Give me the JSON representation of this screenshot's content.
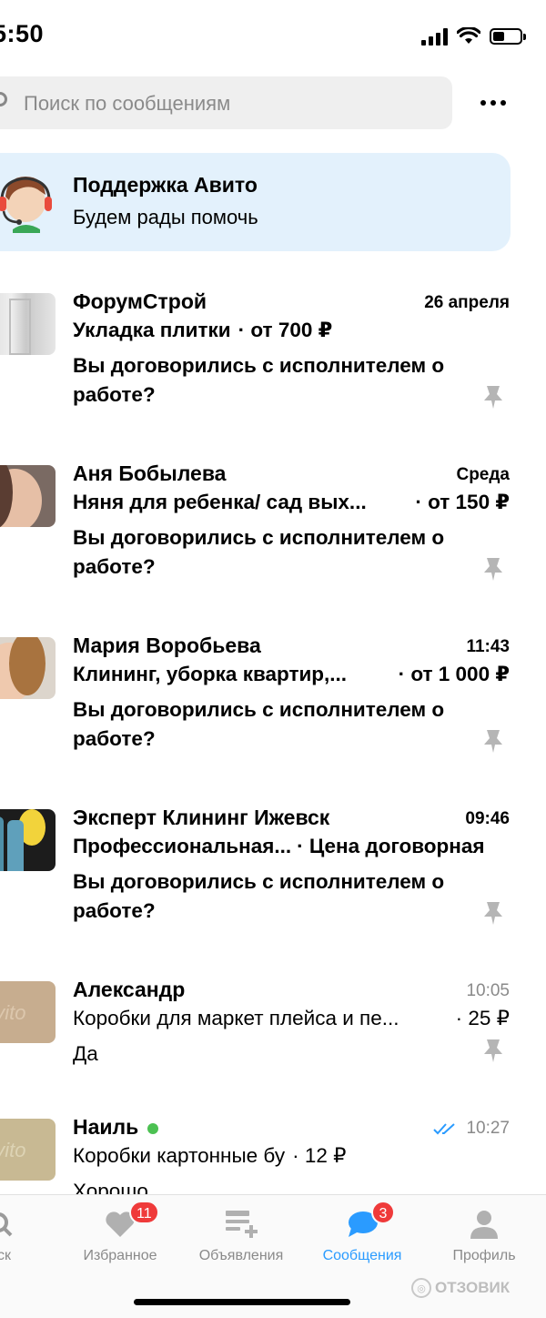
{
  "status_bar": {
    "time": "5:50"
  },
  "search": {
    "placeholder": "Поиск по сообщениям"
  },
  "support": {
    "title": "Поддержка Авито",
    "subtitle": "Будем рады помочь"
  },
  "chats": [
    {
      "name": "ФорумСтрой",
      "date": "26 апреля",
      "item": "Укладка плитки",
      "price": "· от 700 ₽",
      "message": "Вы договорились с исполнителем о работе?",
      "read": false
    },
    {
      "name": "Аня Бобылева",
      "date": "Среда",
      "item": "Няня для ребенка/ сад вых...",
      "price": "· от 150 ₽",
      "message": "Вы договорились с исполнителем о работе?",
      "read": false
    },
    {
      "name": "Мария Воробьева",
      "date": "11:43",
      "item": "Клининг, уборка квартир,...",
      "price": "· от 1 000 ₽",
      "message": "Вы договорились с исполнителем о работе?",
      "read": false
    },
    {
      "name": "Эксперт Клининг Ижевск",
      "date": "09:46",
      "item": "Профессиональная...",
      "price": "· Цена договорная",
      "message": "Вы договорились с исполнителем о работе?",
      "read": false
    },
    {
      "name": "Александр",
      "date": "10:05",
      "item": "Коробки для маркет плейса и пе...",
      "price": "· 25 ₽",
      "message": "Да",
      "read": true
    },
    {
      "name": "Наиль",
      "date": "10:27",
      "item": "Коробки картонные бу",
      "price": "· 12 ₽",
      "message": "Хорошо",
      "read": true,
      "online": true,
      "delivered": true
    }
  ],
  "tabbar": {
    "tabs": [
      {
        "label": "иск",
        "icon": "search-icon"
      },
      {
        "label": "Избранное",
        "icon": "heart-icon",
        "badge": "11"
      },
      {
        "label": "Объявления",
        "icon": "listings-add-icon"
      },
      {
        "label": "Сообщения",
        "icon": "chat-bubble-icon",
        "badge": "3",
        "active": true
      },
      {
        "label": "Профиль",
        "icon": "profile-icon"
      }
    ]
  },
  "watermark": "ОТЗОВИК",
  "colors": {
    "accent": "#2a9bff",
    "badge": "#ef3a3a",
    "support_bg": "#e3f1fc",
    "online": "#4cc152"
  }
}
